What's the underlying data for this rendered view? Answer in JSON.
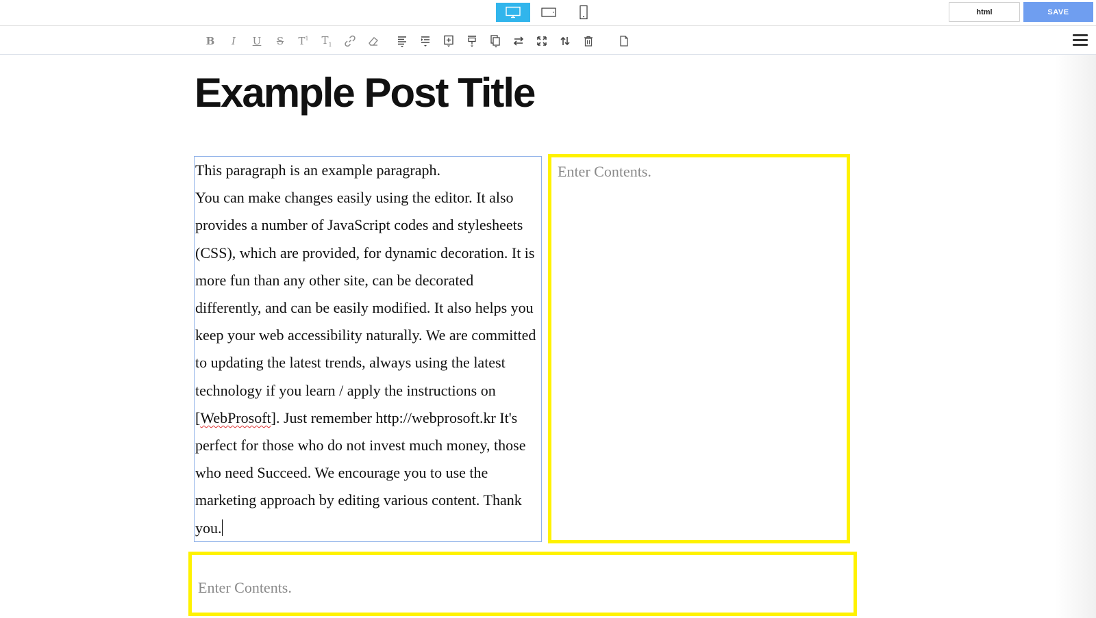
{
  "topbar": {
    "devices": [
      {
        "name": "desktop",
        "icon": "desktop-icon",
        "active": true
      },
      {
        "name": "tablet",
        "icon": "tablet-icon",
        "active": false
      },
      {
        "name": "mobile",
        "icon": "mobile-icon",
        "active": false
      }
    ],
    "html_label": "html",
    "save_label": "SAVE",
    "accent_color": "#31b5ec",
    "save_color": "#6f9ef0"
  },
  "toolbar": {
    "tools": [
      {
        "name": "bold-icon",
        "glyph": "B"
      },
      {
        "name": "italic-icon",
        "glyph": "I"
      },
      {
        "name": "underline-icon",
        "glyph": "U"
      },
      {
        "name": "strikethrough-icon",
        "glyph": "S"
      },
      {
        "name": "superscript-icon",
        "glyph": "T"
      },
      {
        "name": "subscript-icon",
        "glyph": "T"
      },
      {
        "name": "link-icon"
      },
      {
        "name": "eraser-icon"
      },
      {
        "name": "align-icon"
      },
      {
        "name": "indent-icon"
      },
      {
        "name": "insert-block-icon"
      },
      {
        "name": "insert-above-icon"
      },
      {
        "name": "duplicate-icon"
      },
      {
        "name": "swap-icon"
      },
      {
        "name": "expand-icon"
      },
      {
        "name": "move-icon"
      },
      {
        "name": "delete-icon"
      },
      {
        "name": "page-icon"
      }
    ],
    "menu_icon": "hamburger-icon"
  },
  "content": {
    "post_title": "Example Post Title",
    "paragraph_line1": "This paragraph is an example paragraph.",
    "paragraph_before_link": "You can make changes easily using the editor. It also provides a number of JavaScript codes and stylesheets (CSS), which are provided, for dynamic decoration. It is more fun than any other site, can be decorated differently, and can be easily modified. It also helps you keep your web accessibility naturally. We are committed to updating the latest trends, always using the latest technology if you learn / apply the instructions on [",
    "paragraph_link_word": "WebProsoft",
    "paragraph_after_link": "]. Just remember http://webprosoft.kr It's perfect for those who do not invest much money, those who need Succeed. We encourage you to use the marketing approach by editing various content. Thank you.",
    "right_placeholder": "Enter Contents.",
    "bottom_placeholder": "Enter Contents.",
    "highlight_color": "#fff200"
  }
}
